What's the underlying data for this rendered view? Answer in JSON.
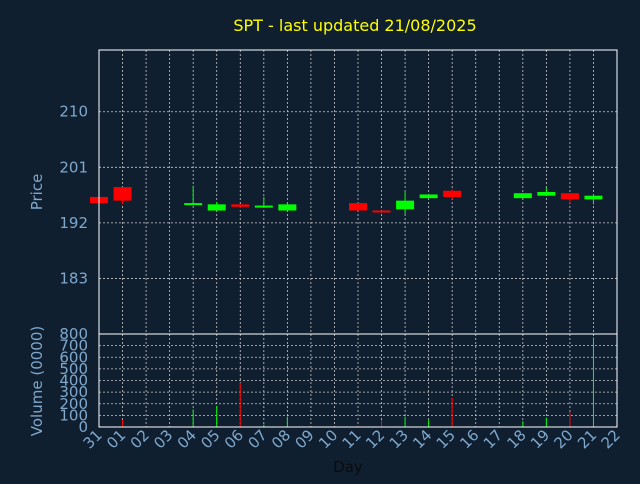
{
  "chart_data": {
    "type": "candlestick",
    "title": "SPT - last updated 21/08/2025",
    "xlabel": "Day",
    "ylabel_price": "Price",
    "ylabel_volume": "Volume (0000)",
    "price_ticks": [
      183,
      192,
      201,
      210
    ],
    "price_range": [
      174,
      220
    ],
    "volume_ticks": [
      0,
      100,
      200,
      300,
      400,
      500,
      600,
      700,
      800
    ],
    "volume_range": [
      0,
      800
    ],
    "x_ticks": [
      "31",
      "01",
      "02",
      "03",
      "04",
      "05",
      "06",
      "07",
      "08",
      "09",
      "10",
      "11",
      "12",
      "13",
      "14",
      "15",
      "16",
      "17",
      "18",
      "19",
      "20",
      "21",
      "22"
    ],
    "grid": true,
    "colors": {
      "up": "#00ff00",
      "down": "#ff0000",
      "title": "#ffff00",
      "axis_text": "#7fa8cc",
      "grid": "#c8c8c8",
      "background": "#0f1f30"
    },
    "candles": [
      {
        "day": "31",
        "open": 196.2,
        "high": 196.4,
        "low": 195.0,
        "close": 195.2
      },
      {
        "day": "01",
        "open": 197.8,
        "high": 197.8,
        "low": 195.0,
        "close": 195.6
      },
      {
        "day": "04",
        "open": 195.0,
        "high": 198.0,
        "low": 195.0,
        "close": 195.2
      },
      {
        "day": "05",
        "open": 194.0,
        "high": 195.4,
        "low": 194.0,
        "close": 195.0
      },
      {
        "day": "06",
        "open": 195.0,
        "high": 195.0,
        "low": 194.4,
        "close": 194.6
      },
      {
        "day": "07",
        "open": 194.6,
        "high": 196.2,
        "low": 194.4,
        "close": 194.8
      },
      {
        "day": "08",
        "open": 194.0,
        "high": 195.2,
        "low": 194.0,
        "close": 195.0
      },
      {
        "day": "11",
        "open": 195.2,
        "high": 195.2,
        "low": 194.0,
        "close": 194.0
      },
      {
        "day": "12",
        "open": 194.0,
        "high": 194.0,
        "low": 193.6,
        "close": 193.8
      },
      {
        "day": "13",
        "open": 194.2,
        "high": 197.2,
        "low": 193.4,
        "close": 195.6
      },
      {
        "day": "14",
        "open": 196.0,
        "high": 196.6,
        "low": 196.0,
        "close": 196.6
      },
      {
        "day": "15",
        "open": 197.2,
        "high": 197.4,
        "low": 195.8,
        "close": 196.2
      },
      {
        "day": "18",
        "open": 196.0,
        "high": 196.8,
        "low": 196.0,
        "close": 196.8
      },
      {
        "day": "19",
        "open": 196.4,
        "high": 197.8,
        "low": 196.4,
        "close": 197.0
      },
      {
        "day": "20",
        "open": 196.8,
        "high": 196.8,
        "low": 195.2,
        "close": 195.8
      },
      {
        "day": "21",
        "open": 195.8,
        "high": 196.6,
        "low": 195.0,
        "close": 196.4
      }
    ],
    "volumes": [
      {
        "day": "31",
        "value": 10,
        "dir": "down"
      },
      {
        "day": "01",
        "value": 60,
        "dir": "down"
      },
      {
        "day": "04",
        "value": 150,
        "dir": "up"
      },
      {
        "day": "05",
        "value": 180,
        "dir": "up"
      },
      {
        "day": "06",
        "value": 380,
        "dir": "down"
      },
      {
        "day": "07",
        "value": 20,
        "dir": "up"
      },
      {
        "day": "08",
        "value": 90,
        "dir": "up"
      },
      {
        "day": "11",
        "value": 10,
        "dir": "down"
      },
      {
        "day": "12",
        "value": 60,
        "dir": "down"
      },
      {
        "day": "13",
        "value": 90,
        "dir": "up"
      },
      {
        "day": "14",
        "value": 60,
        "dir": "up"
      },
      {
        "day": "15",
        "value": 250,
        "dir": "down"
      },
      {
        "day": "18",
        "value": 50,
        "dir": "up"
      },
      {
        "day": "19",
        "value": 80,
        "dir": "up"
      },
      {
        "day": "20",
        "value": 130,
        "dir": "down"
      },
      {
        "day": "21",
        "value": 770,
        "dir": "up"
      }
    ]
  }
}
